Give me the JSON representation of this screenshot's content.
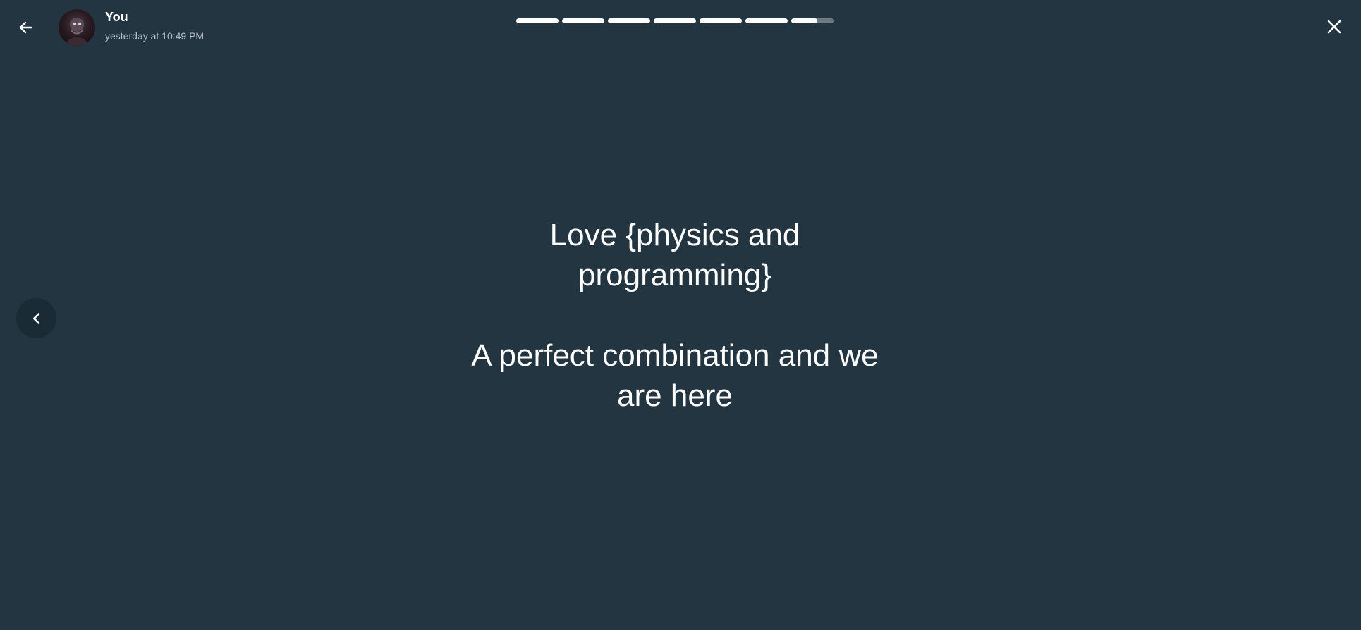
{
  "header": {
    "author": "You",
    "timestamp": "yesterday at 10:49 PM",
    "avatar_icon": "profile-photo",
    "back_icon": "arrow-left-icon",
    "close_icon": "close-icon"
  },
  "progress": {
    "segments": [
      1,
      1,
      1,
      1,
      1,
      1,
      0.62
    ]
  },
  "story": {
    "text": "Love {physics and\nprogramming}\n\nA perfect combination and we\nare here",
    "background_color": "#233541"
  },
  "navigation": {
    "prev_icon": "chevron-left-icon"
  }
}
